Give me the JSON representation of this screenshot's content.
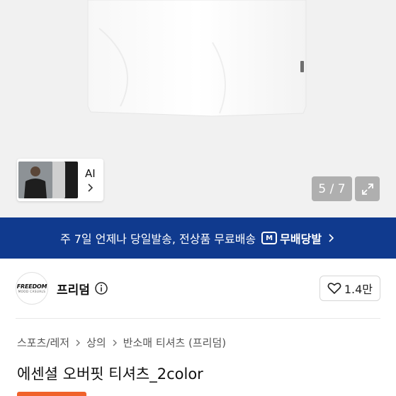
{
  "gallery": {
    "counter": "5 / 7",
    "ai_label": "AI",
    "colors": {
      "background": "#f1f1f1",
      "shirt": "#ffffff"
    }
  },
  "banner": {
    "text": "주 7일 언제나 당일발송, 전상품 무료배송",
    "logo_mark": "M",
    "logo_text": "무배당발",
    "background": "#103a8e"
  },
  "brand": {
    "logo_line1": "FREEDOM",
    "logo_line2": "MOOD CASUALS",
    "name": "프리덤",
    "likes": "1.4만"
  },
  "breadcrumb": [
    "스포츠/레저",
    "상의",
    "반소매 티셔츠 (프리덤)"
  ],
  "product": {
    "title": "에센셜 오버핏 티셔츠_2color",
    "badge_color": "#f0622a"
  }
}
